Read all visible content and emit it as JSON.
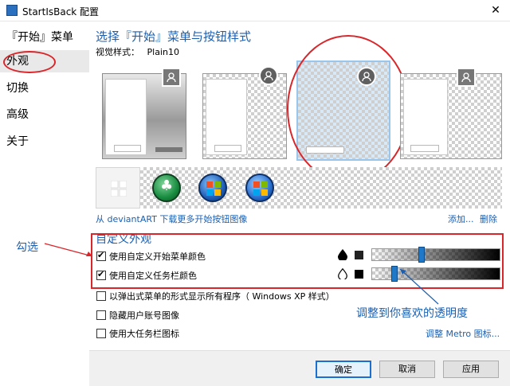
{
  "window": {
    "title": "StartIsBack 配置",
    "close_label": "✕"
  },
  "sidebar": {
    "items": [
      {
        "label": "『开始』菜单"
      },
      {
        "label": "外观"
      },
      {
        "label": "切换"
      },
      {
        "label": "高级"
      },
      {
        "label": "关于"
      }
    ]
  },
  "main": {
    "heading": "选择『开始』菜单与按钮样式",
    "visual_style_label": "视觉样式：",
    "visual_style_value": "Plain10",
    "download_link": "从 deviantART 下载更多开始按钮图像",
    "add_link": "添加...",
    "delete_link": "删除",
    "custom_group_title": "自定义外观",
    "options": [
      {
        "label": "使用自定义开始菜单颜色",
        "checked": true
      },
      {
        "label": "使用自定义任务栏颜色",
        "checked": true
      },
      {
        "label": "以弹出式菜单的形式显示所有程序（ Windows XP 样式）",
        "checked": false
      },
      {
        "label": "隐藏用户账号图像",
        "checked": false
      },
      {
        "label": "使用大任务栏图标",
        "checked": false
      }
    ],
    "menu_opacity": 0.38,
    "taskbar_opacity": 0.16,
    "metro_link": "调整 Metro 图标..."
  },
  "buttons": {
    "ok": "确定",
    "cancel": "取消",
    "apply": "应用"
  },
  "annotations": {
    "check_hint": "勾选",
    "opacity_hint": "调整到你喜欢的透明度"
  },
  "colors": {
    "accent": "#1c5fb0",
    "annotation_red": "#d9262a",
    "slider_thumb": "#1f78c8"
  }
}
